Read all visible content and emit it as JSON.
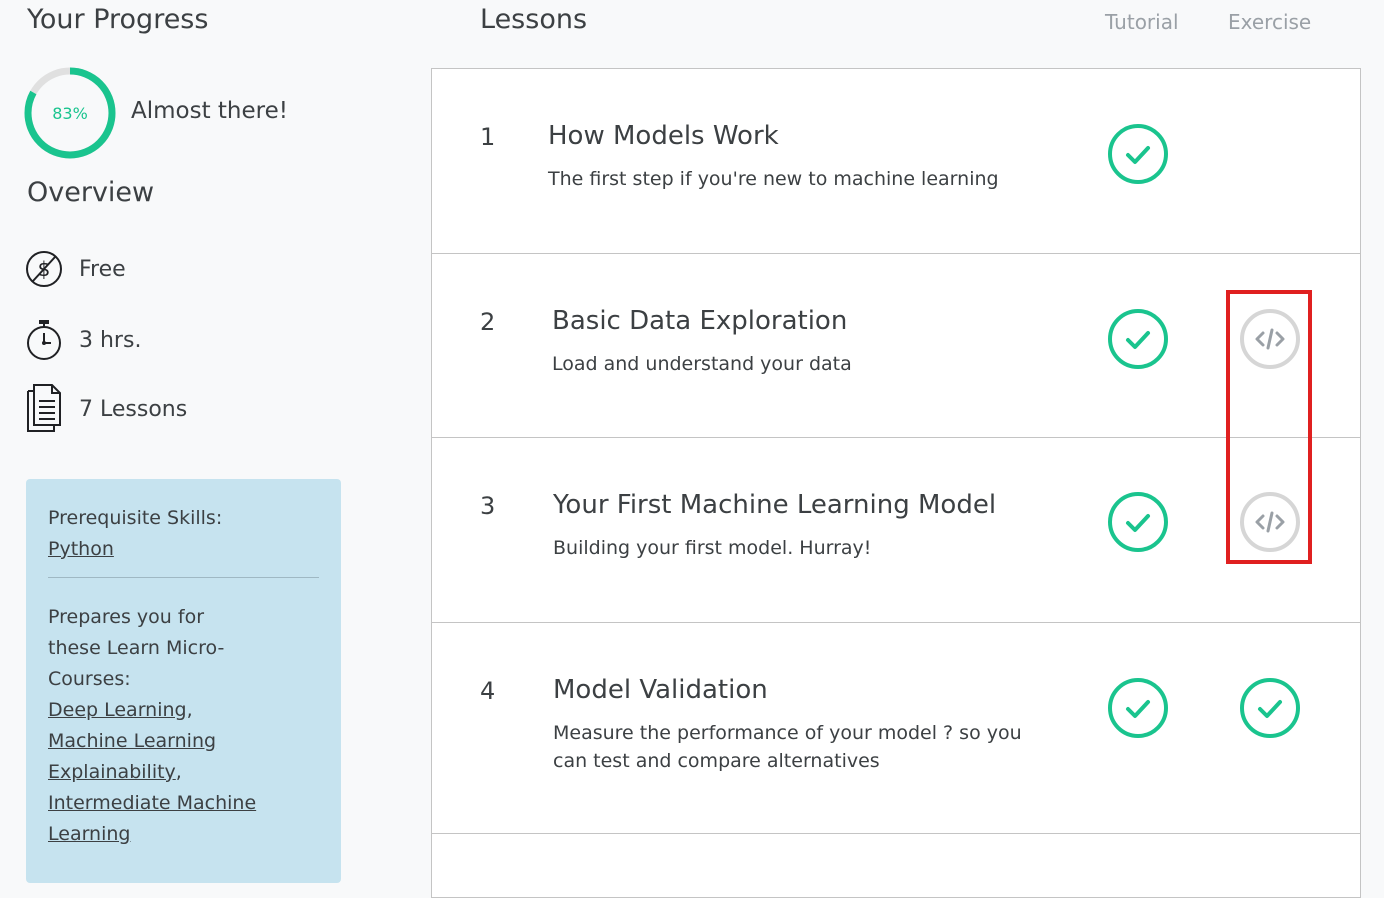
{
  "sidebar": {
    "progress_title": "Your Progress",
    "progress_percent": "83%",
    "progress_value": 0.83,
    "progress_message": "Almost there!",
    "overview_title": "Overview",
    "overview_items": [
      {
        "icon": "no-dollar-icon",
        "text": "Free"
      },
      {
        "icon": "stopwatch-icon",
        "text": "3 hrs."
      },
      {
        "icon": "document-icon",
        "text": "7 Lessons"
      }
    ],
    "prereq_label": "Prerequisite Skills:",
    "prereq_link": "Python",
    "prepares_label": "Prepares you for these Learn Micro-Courses:",
    "courses": [
      "Deep Learning",
      "Machine Learning Explainability",
      "Intermediate Machine Learning"
    ]
  },
  "lessons": {
    "title": "Lessons",
    "col_tutorial": "Tutorial",
    "col_exercise": "Exercise",
    "items": [
      {
        "num": "1",
        "title": "How Models Work",
        "desc": "The first step if you're new to machine learning",
        "tutorial": "complete",
        "exercise": "none"
      },
      {
        "num": "2",
        "title": "Basic Data Exploration",
        "desc": "Load and understand your data",
        "tutorial": "complete",
        "exercise": "incomplete"
      },
      {
        "num": "3",
        "title": "Your First Machine Learning Model",
        "desc": "Building your first model. Hurray!",
        "tutorial": "complete",
        "exercise": "incomplete"
      },
      {
        "num": "4",
        "title": "Model Validation",
        "desc": "Measure the performance of your model ? so you can test and compare alternatives",
        "tutorial": "complete",
        "exercise": "complete"
      }
    ]
  },
  "colors": {
    "accent_green": "#1ac48e",
    "ring_track": "#e0e0e0",
    "pending_gray": "#d6d6d6",
    "highlight_red": "#e02020",
    "info_box": "#c6e3ef"
  }
}
